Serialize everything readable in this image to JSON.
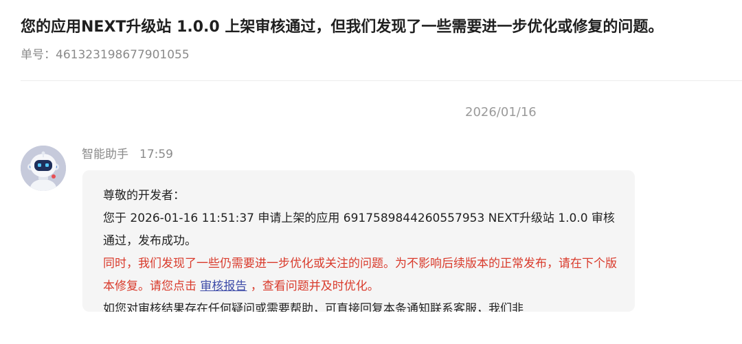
{
  "ticket": {
    "title": "您的应用NEXT升级站 1.0.0 上架审核通过，但我们发现了一些需要进一步优化或修复的问题。",
    "number_label": "单号：",
    "number": "461323198677901055"
  },
  "conversation": {
    "date": "2026/01/16",
    "message": {
      "sender": "智能助手",
      "time": "17:59",
      "greeting": "尊敬的开发者：",
      "body_line": "您于 2026-01-16 11:51:37 申请上架的应用 6917589844260557953 NEXT升级站 1.0.0 审核通过，发布成功。",
      "warning_part1": "同时，我们发现了一些仍需要进一步优化或关注的问题。为不影响后续版本的正常发布，请在下个版本修复。请您点击 ",
      "report_link": "审核报告",
      "warning_part2": " ，查看问题并及时优化。",
      "footer_line": "如您对审核结果存在任何疑问或需要帮助，可直接回复本条通知联系客服，我们非"
    }
  },
  "colors": {
    "warning_text": "#d93a2b",
    "link_text": "#3d4ba8",
    "bubble_bg": "#f5f5f5",
    "muted_text": "#8a8a8a"
  }
}
